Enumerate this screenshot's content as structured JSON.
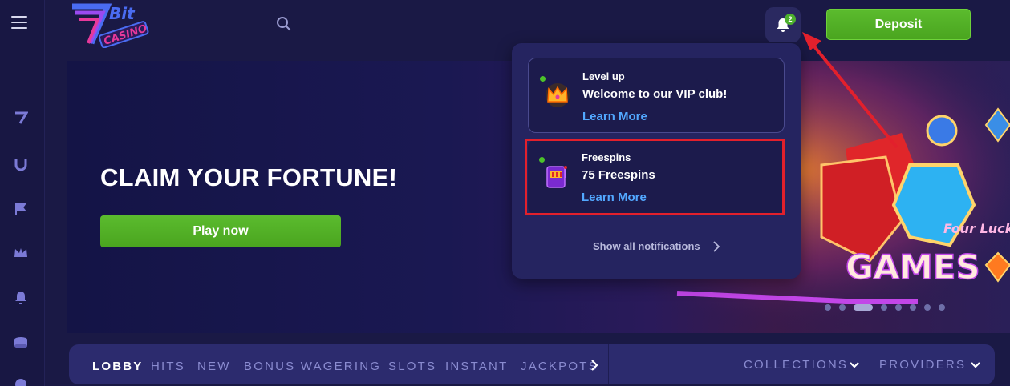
{
  "brand": {
    "name": "7Bit Casino",
    "logo_text_top": "Bit",
    "logo_text_bottom": "CASINO",
    "accent": "#e6399b",
    "green": "#4caf2d"
  },
  "header": {
    "search_icon": "search-icon",
    "notifications": {
      "icon": "bell-icon",
      "count": "2"
    },
    "deposit_label": "Deposit"
  },
  "sidebar": {
    "items": [
      "menu-icon",
      "seven-icon",
      "crown-u-icon",
      "flags-icon",
      "crown-icon",
      "bell-icon",
      "coins-icon"
    ]
  },
  "banner": {
    "headline": "CLAIM YOUR FORTUNE!",
    "cta": "Play now",
    "art_title": "GAMES",
    "art_game": "Four Lucky Diamonds",
    "slides": 9,
    "active_slide": 3
  },
  "notifications": {
    "items": [
      {
        "category": "Level up",
        "message": "Welcome to our VIP club!",
        "link": "Learn More",
        "icon": "crown-icon"
      },
      {
        "category": "Freespins",
        "message": "75 Freespins",
        "link": "Learn More",
        "icon": "slot-machine-icon"
      }
    ],
    "show_all": "Show all notifications"
  },
  "categories": {
    "tabs": [
      "LOBBY",
      "HITS",
      "NEW",
      "BONUS WAGERING",
      "SLOTS",
      "INSTANT",
      "JACKPOTS"
    ],
    "active": "LOBBY",
    "dropdowns": [
      "COLLECTIONS",
      "PROVIDERS"
    ]
  }
}
